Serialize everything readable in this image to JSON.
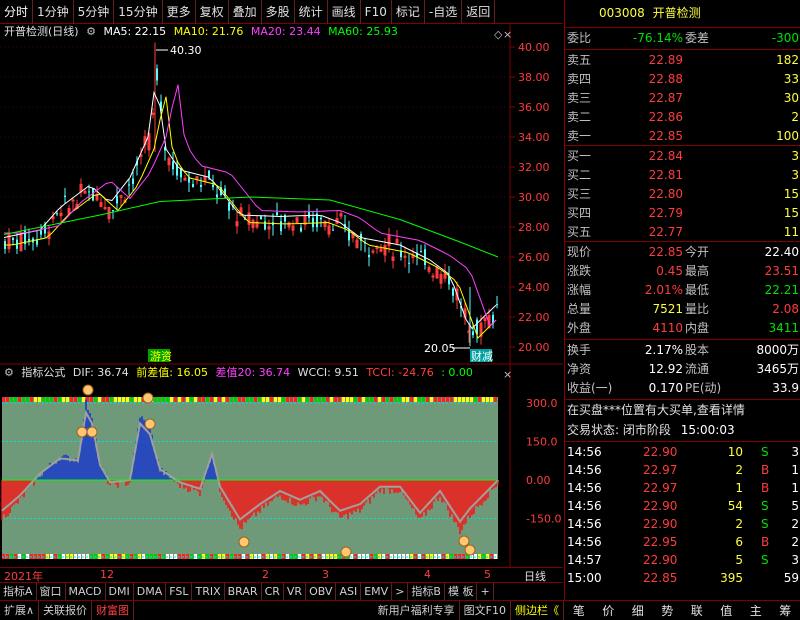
{
  "toolbar": {
    "items": [
      "分时",
      "1分钟",
      "5分钟",
      "15分钟",
      "更多",
      "复权",
      "叠加",
      "多股",
      "统计",
      "画线",
      "F10",
      "标记",
      "-自选",
      "返回"
    ]
  },
  "chart": {
    "title": "开普检测(日线)",
    "ma5_label": "MA5: 22.15",
    "ma10_label": "MA10: 21.76",
    "ma20_label": "MA20: 23.44",
    "ma60_label": "MA60: 25.93",
    "price_ticks": [
      "40.00",
      "38.00",
      "36.00",
      "34.00",
      "32.00",
      "30.00",
      "28.00",
      "26.00",
      "24.00",
      "22.00",
      "20.00"
    ],
    "high_label": "40.30",
    "low_label": "20.05",
    "badge_left": "游资",
    "badge_right": "财减",
    "colors": {
      "ma5": "#ffffff",
      "ma10": "#ffff00",
      "ma20": "#ff40ff",
      "ma60": "#00ff00",
      "up": "#ff3c3c",
      "down": "#54ffff"
    }
  },
  "indicator": {
    "name": "指标公式",
    "dif_label": "DIF: 36.74",
    "prev_label": "前差值: 16.05",
    "diff20_label": "差值20: 36.74",
    "wcci_label": "WCCI: 9.51",
    "tcci_label": "TCCI: -24.76",
    "extra_label": ": 0.00",
    "ticks": [
      "300.0",
      "150.0",
      "0.00",
      "-150.0"
    ]
  },
  "date_axis": {
    "labels": [
      "2021年",
      "12",
      "2",
      "3",
      "4",
      "5"
    ],
    "right_label": "日线"
  },
  "tabs": [
    "指标A",
    "窗口",
    "MACD",
    "DMI",
    "DMA",
    "FSL",
    "TRIX",
    "BRAR",
    "CR",
    "VR",
    "OBV",
    "ASI",
    "EMV",
    ">",
    "指标B",
    "模 板",
    "+"
  ],
  "bottom": {
    "left": [
      "扩展∧",
      "关联报价",
      "财富图"
    ],
    "right": [
      "新用户福利专享",
      "图文F10",
      "侧边栏《"
    ],
    "panel_buttons": [
      "笔",
      "价",
      "细",
      "势",
      "联",
      "值",
      "主",
      "筹"
    ]
  },
  "quote": {
    "code": "003008",
    "name": "开普检测",
    "weibi_label": "委比",
    "weibi": "-76.14%",
    "weicha_label": "委差",
    "weicha": "-300",
    "asks": [
      {
        "label": "卖五",
        "price": "22.89",
        "vol": "182"
      },
      {
        "label": "卖四",
        "price": "22.88",
        "vol": "33"
      },
      {
        "label": "卖三",
        "price": "22.87",
        "vol": "30"
      },
      {
        "label": "卖二",
        "price": "22.86",
        "vol": "2"
      },
      {
        "label": "卖一",
        "price": "22.85",
        "vol": "100"
      }
    ],
    "bids": [
      {
        "label": "买一",
        "price": "22.84",
        "vol": "3"
      },
      {
        "label": "买二",
        "price": "22.81",
        "vol": "3"
      },
      {
        "label": "买三",
        "price": "22.80",
        "vol": "15"
      },
      {
        "label": "买四",
        "price": "22.79",
        "vol": "15"
      },
      {
        "label": "买五",
        "price": "22.77",
        "vol": "11"
      }
    ],
    "stats": [
      {
        "l1": "现价",
        "v1": "22.85",
        "c1": "red",
        "l2": "今开",
        "v2": "22.40",
        "c2": "wht"
      },
      {
        "l1": "涨跌",
        "v1": "0.45",
        "c1": "red",
        "l2": "最高",
        "v2": "23.51",
        "c2": "red"
      },
      {
        "l1": "涨幅",
        "v1": "2.01%",
        "c1": "red",
        "l2": "最低",
        "v2": "22.21",
        "c2": "green"
      },
      {
        "l1": "总量",
        "v1": "7521",
        "c1": "yel",
        "l2": "量比",
        "v2": "2.08",
        "c2": "red"
      },
      {
        "l1": "外盘",
        "v1": "4110",
        "c1": "red",
        "l2": "内盘",
        "v2": "3411",
        "c2": "green"
      }
    ],
    "stats2": [
      {
        "l1": "换手",
        "v1": "2.17%",
        "l2": "股本",
        "v2": "8000万"
      },
      {
        "l1": "净资",
        "v1": "12.92",
        "l2": "流通",
        "v2": "3465万"
      },
      {
        "l1": "收益(一)",
        "v1": "0.170",
        "l2": "PE(动)",
        "v2": "33.9"
      }
    ],
    "notice": "在买盘***位置有大买单,查看详情",
    "status_label": "交易状态: 闭市阶段",
    "status_time": "15:00:03",
    "ticks": [
      {
        "time": "14:56",
        "price": "22.90",
        "vol": "10",
        "bs": "S",
        "n": "3"
      },
      {
        "time": "14:56",
        "price": "22.97",
        "vol": "2",
        "bs": "B",
        "n": "1"
      },
      {
        "time": "14:56",
        "price": "22.97",
        "vol": "1",
        "bs": "B",
        "n": "1"
      },
      {
        "time": "14:56",
        "price": "22.90",
        "vol": "54",
        "bs": "S",
        "n": "5"
      },
      {
        "time": "14:56",
        "price": "22.90",
        "vol": "2",
        "bs": "S",
        "n": "2"
      },
      {
        "time": "14:56",
        "price": "22.95",
        "vol": "6",
        "bs": "B",
        "n": "2"
      },
      {
        "time": "14:57",
        "price": "22.90",
        "vol": "5",
        "bs": "S",
        "n": "3"
      },
      {
        "time": "15:00",
        "price": "22.85",
        "vol": "395",
        "bs": "",
        "n": "59"
      }
    ]
  }
}
